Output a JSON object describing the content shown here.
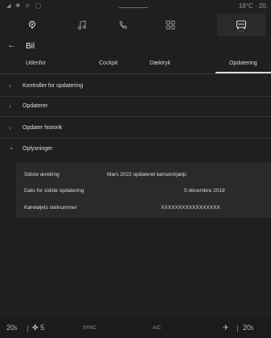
{
  "status": {
    "left_icons": "◢ ✱ ᯤ ◯",
    "right_text": "16°C · 20."
  },
  "nav": {
    "items": [
      {
        "icon": "map-pin-icon"
      },
      {
        "icon": "music-note-icon"
      },
      {
        "icon": "phone-icon"
      },
      {
        "icon": "apps-grid-icon"
      },
      {
        "icon": "car-icon"
      }
    ],
    "active_dots": "⋯"
  },
  "header": {
    "back_icon": "←",
    "title": "Bil"
  },
  "tabs": [
    "Udenfor",
    "Cockpit",
    "Dæktryk",
    "Opdatering"
  ],
  "sections": [
    {
      "chevron": "›",
      "label": "Kontroller for opdatering"
    },
    {
      "chevron": "›",
      "label": "Opdaterer"
    },
    {
      "chevron": "›",
      "label": "Opdater historik"
    },
    {
      "chevron": "⌄",
      "label": "Oplysninger"
    }
  ],
  "info": [
    {
      "key": "Sidste ændring",
      "value": "Mars 2022 opdateret kørselshjælp"
    },
    {
      "key": "Dato for sidste opdatering",
      "value": "5 décembre 2019"
    },
    {
      "key": "Køretøjets stelnummer",
      "value": "XXXXXXXXXXXXXXXXX"
    }
  ],
  "bottom": {
    "temp_left": "20",
    "temp_left_frac": "5",
    "fan_label": "5",
    "sync": "SYNC",
    "ac": "A/C",
    "temp_right": "20",
    "temp_right_frac": "5"
  },
  "colors": {
    "background": "#1f1f21",
    "panel": "#2a2a2c",
    "text": "#e6e6e6"
  }
}
